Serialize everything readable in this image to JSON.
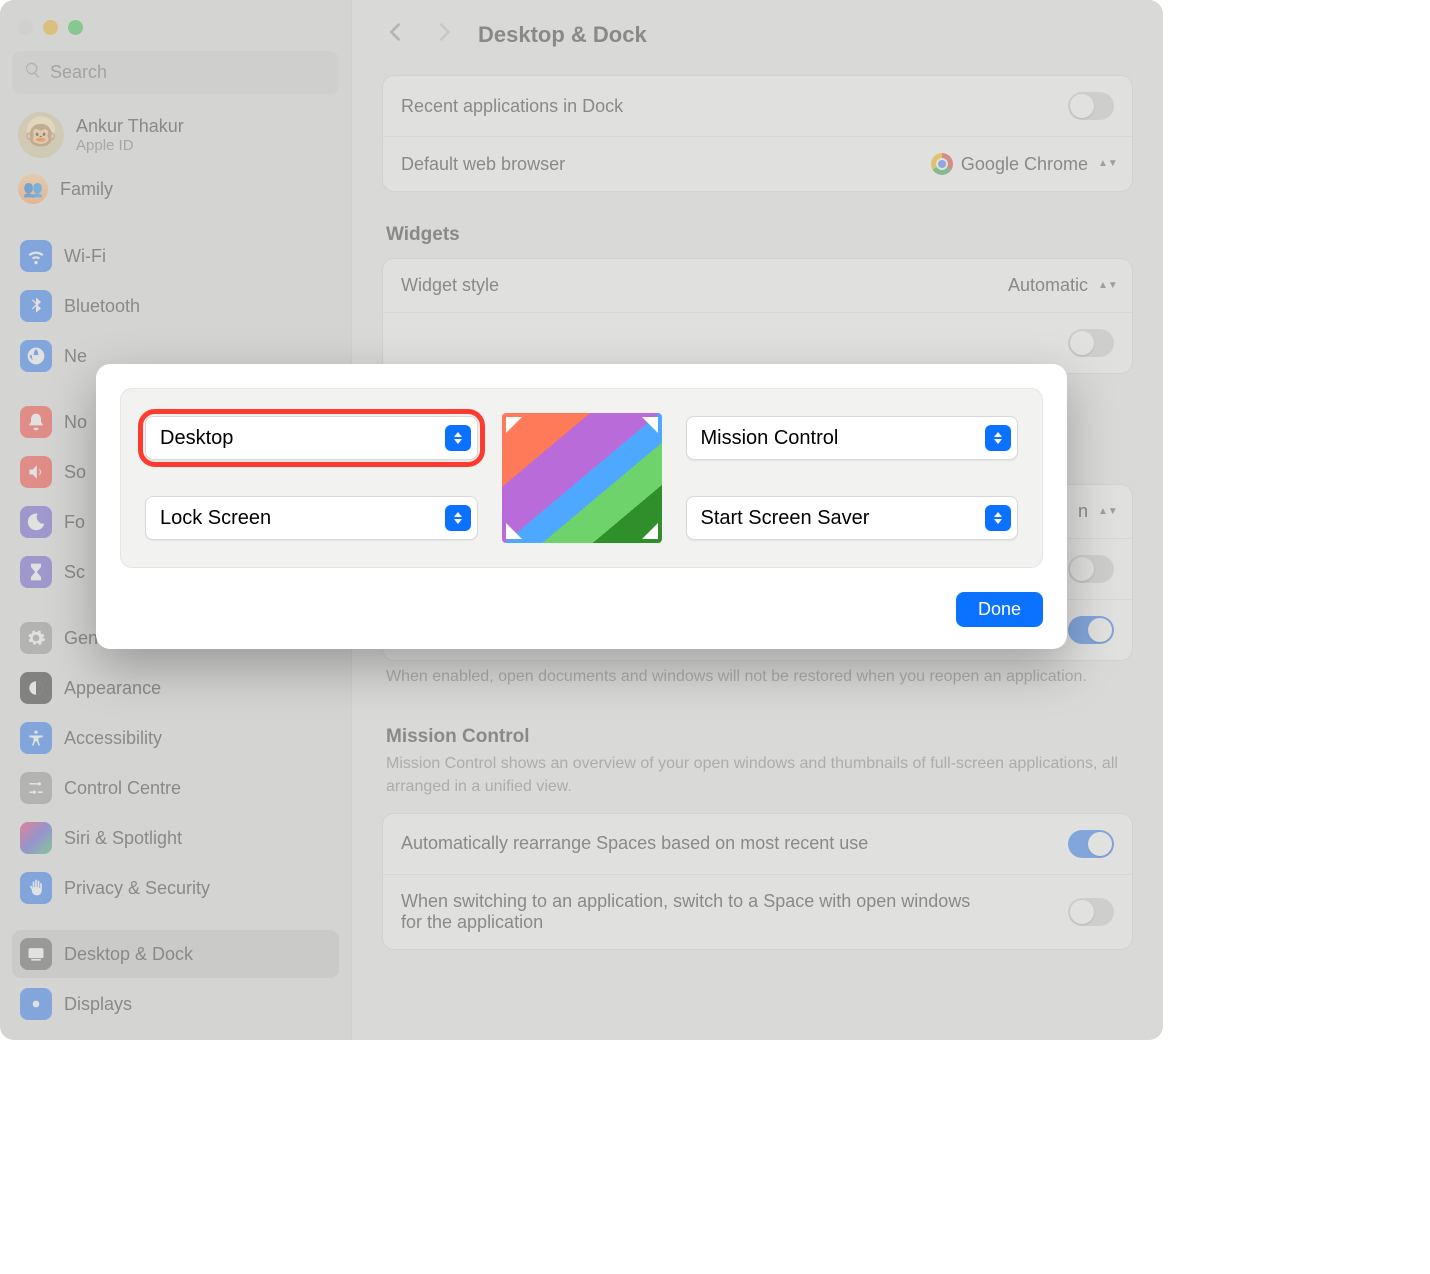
{
  "window": {
    "title": "Desktop & Dock",
    "search_placeholder": "Search"
  },
  "user": {
    "name": "Ankur Thakur",
    "sub": "Apple ID",
    "family_label": "Family"
  },
  "sidebar": {
    "group1": [
      {
        "label": "Wi-Fi",
        "bg": "#2E7CF6"
      },
      {
        "label": "Bluetooth",
        "bg": "#2E7CF6"
      },
      {
        "label": "Ne",
        "bg": "#2E7CF6"
      }
    ],
    "group2": [
      {
        "label": "No",
        "bg": "#FF453A"
      },
      {
        "label": "So",
        "bg": "#FF453A"
      },
      {
        "label": "Fo",
        "bg": "#6E5DD6"
      },
      {
        "label": "Sc",
        "bg": "#6E5DD6"
      }
    ],
    "group3": [
      {
        "label": "General",
        "bg": "#9A9A98"
      },
      {
        "label": "Appearance",
        "bg": "#2D2D2D"
      },
      {
        "label": "Accessibility",
        "bg": "#2E7CF6"
      },
      {
        "label": "Control Centre",
        "bg": "#9A9A98"
      },
      {
        "label": "Siri & Spotlight",
        "bg": "linear-gradient(135deg,#ff2d55,#5856d6,#34c759)"
      },
      {
        "label": "Privacy & Security",
        "bg": "#2E7CF6"
      }
    ],
    "group4": [
      {
        "label": "Desktop & Dock",
        "bg": "#5f5f5d",
        "active": true
      },
      {
        "label": "Displays",
        "bg": "#2E7CF6"
      }
    ]
  },
  "main": {
    "recent_apps_label": "Recent applications in Dock",
    "default_browser_label": "Default web browser",
    "default_browser_value": "Google Chrome",
    "widgets_label": "Widgets",
    "widget_style_label": "Widget style",
    "widget_style_value": "Automatic",
    "close_desc": "When enabled, open documents and windows will not be restored when you reopen an application.",
    "mission_control_label": "Mission Control",
    "mission_control_desc": "Mission Control shows an overview of your open windows and thumbnails of full-screen applications, all arranged in a unified view.",
    "auto_rearrange_label": "Automatically rearrange Spaces based on most recent use",
    "switch_space_label": "When switching to an application, switch to a Space with open windows for the application",
    "partial_n_value": "n"
  },
  "modal": {
    "top_left": "Desktop",
    "top_right": "Mission Control",
    "bottom_left": "Lock Screen",
    "bottom_right": "Start Screen Saver",
    "done_label": "Done"
  }
}
